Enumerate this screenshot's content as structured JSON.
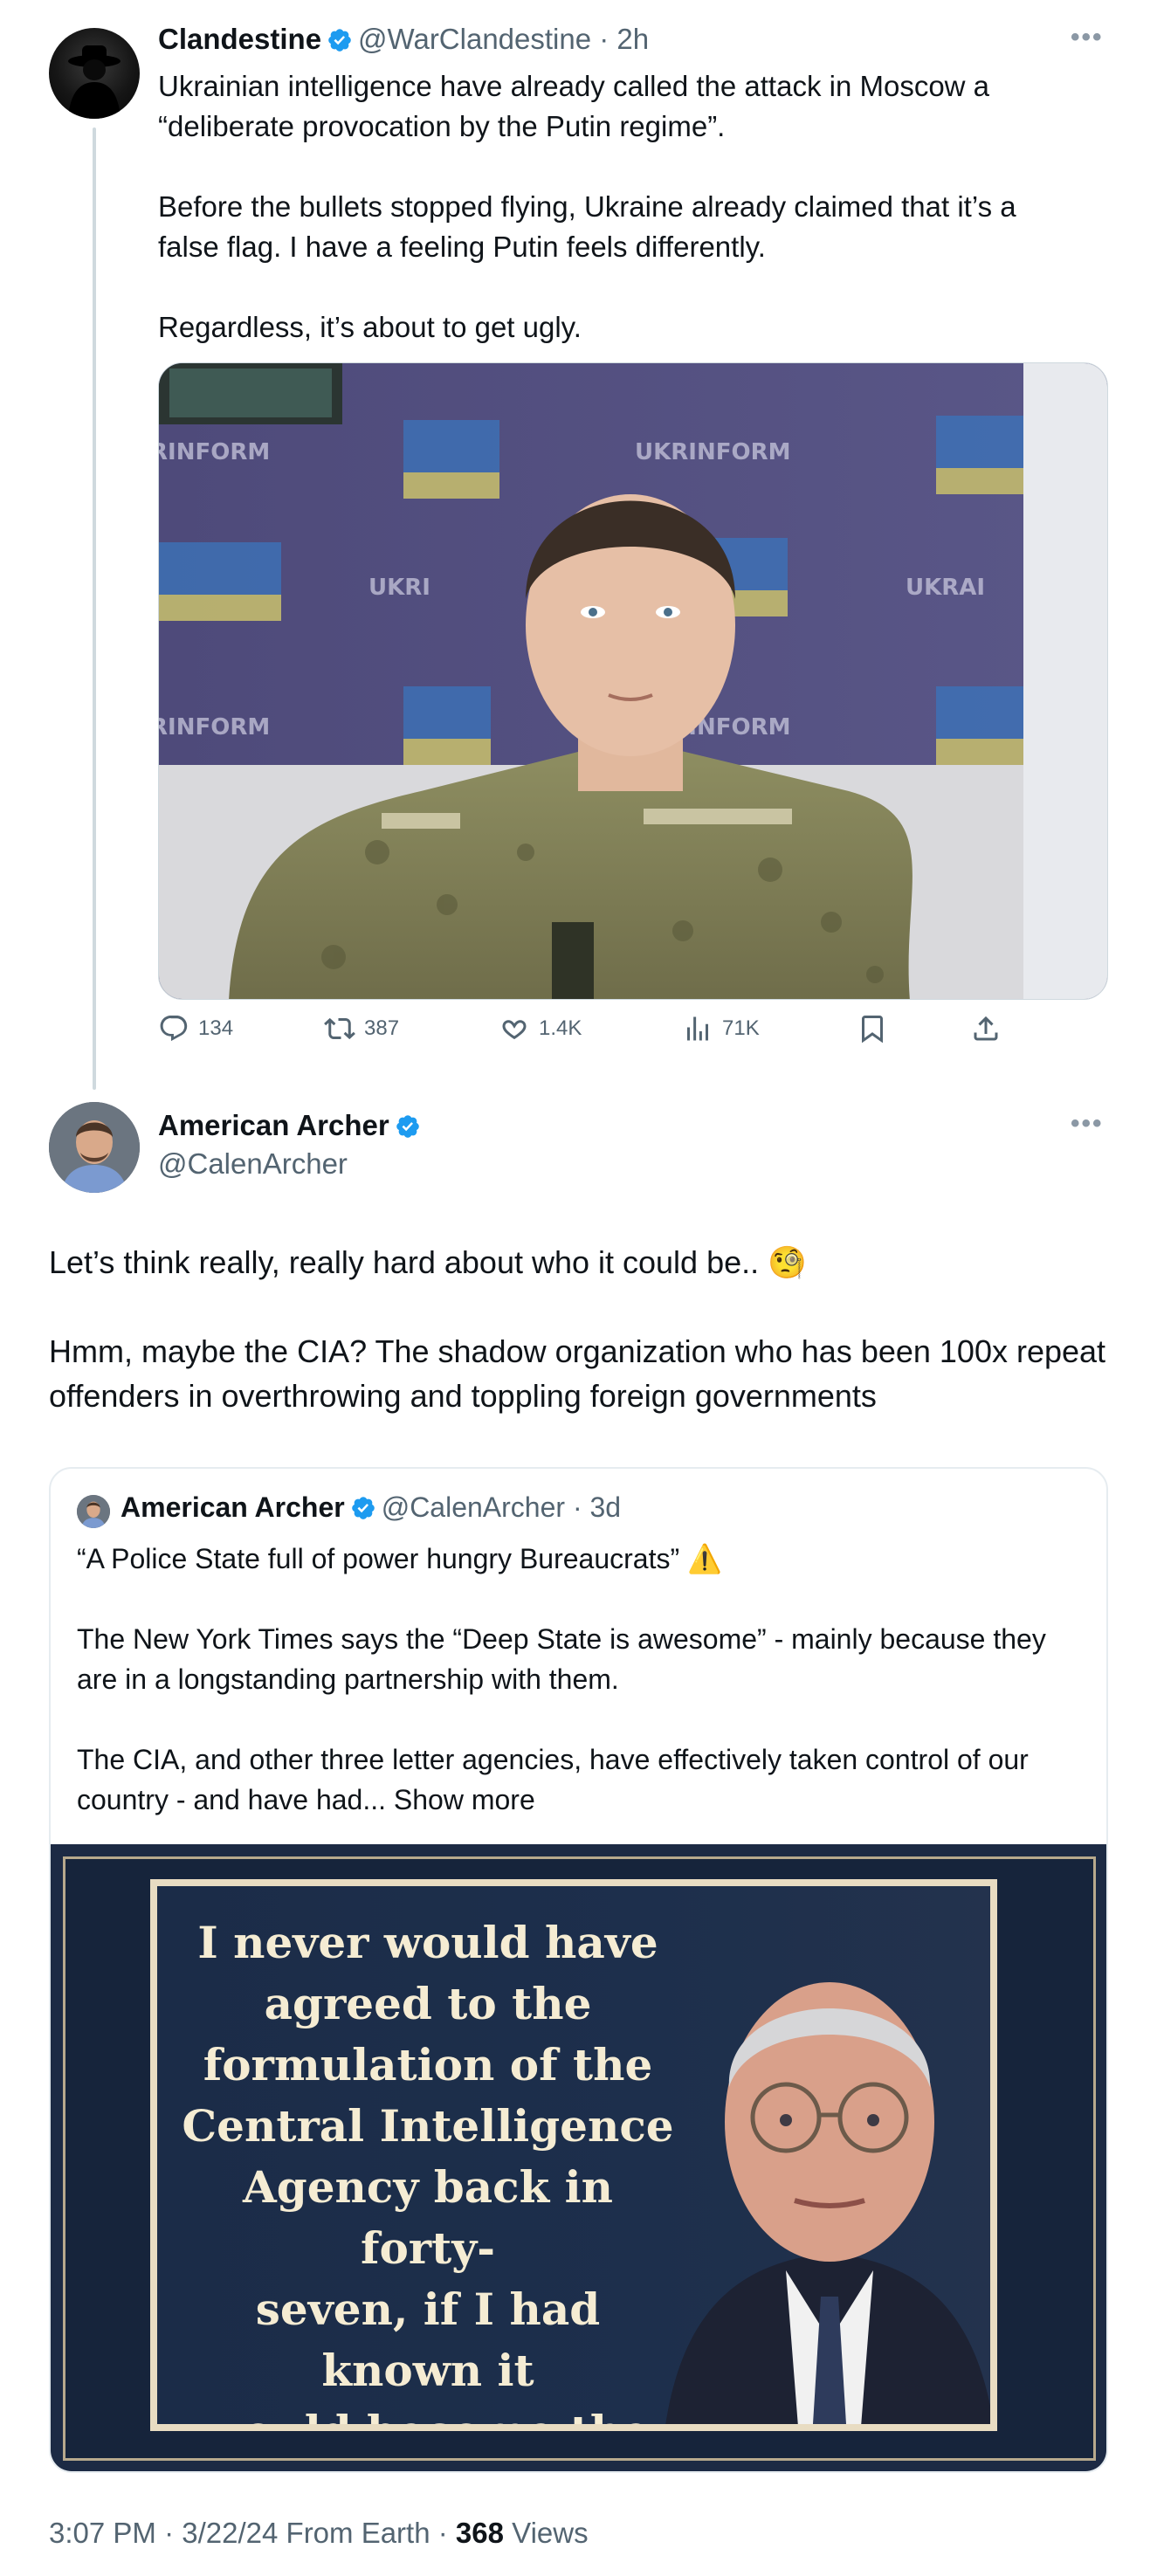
{
  "tweet": {
    "author": {
      "name": "Clandestine",
      "handle": "@WarClandestine",
      "time": "2h",
      "verified": true
    },
    "text": "Ukrainian intelligence have already called the attack in Moscow a “deliberate provocation by the Putin regime”.\n\nBefore the bullets stopped flying, Ukraine already claimed that it’s a false flag. I have a feeling Putin feels differently.\n\nRegardless, it’s about to get ugly.",
    "media_background_text": [
      "RINFORM",
      "UKRINFORM",
      "UKRAINE",
      "UKRINFORM",
      "UKRAINE",
      "UKRAINE",
      "UKRINFORM"
    ],
    "actions": {
      "replies": "134",
      "retweets": "387",
      "likes": "1.4K",
      "views": "71K"
    }
  },
  "reply": {
    "author": {
      "name": "American Archer",
      "handle": "@CalenArcher",
      "verified": true
    },
    "text": "Let’s think really, really hard about who it could be..",
    "emoji": "🧐",
    "text2": "Hmm, maybe the CIA? The shadow organization who has been 100x repeat offenders in overthrowing and toppling foreign governments",
    "quote": {
      "author": {
        "name": "American Archer",
        "handle": "@CalenArcher",
        "time": "3d"
      },
      "text": "“A Police State full of power hungry Bureaucrats”",
      "warning_emoji": "⚠️",
      "text2": "The New York Times says the “Deep State is awesome” - mainly because they are in a longstanding partnership with them.\n\nThe CIA, and other three letter agencies, have effectively taken control of our country - and have had...",
      "show_more": "Show more",
      "image_quote": "I never would have\nagreed to the\nformulation of the\nCentral Intelligence\nAgency back in forty-\nseven, if I had known it\nwould become the\nAmerican Gestapo"
    },
    "footer": {
      "time": "3:07 PM",
      "date": "3/22/24",
      "source": "From Earth",
      "views_count": "368",
      "views_label": "Views"
    }
  },
  "colors": {
    "verified": "#1d9bf0",
    "secondary_text": "#536471",
    "divider": "#cfd9de"
  }
}
